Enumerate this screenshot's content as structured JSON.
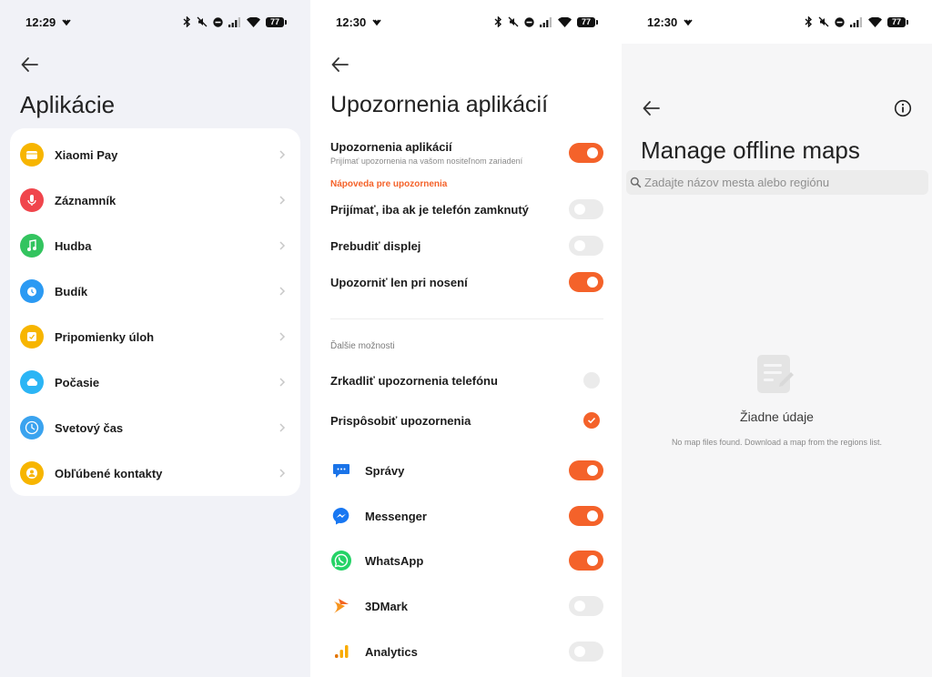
{
  "screen1": {
    "status": {
      "time": "12:29",
      "battery": "77"
    },
    "title": "Aplikácie",
    "apps": [
      {
        "label": "Xiaomi Pay",
        "icon": "wallet-icon",
        "color": "#f7b500"
      },
      {
        "label": "Záznamník",
        "icon": "microphone-icon",
        "color": "#f0454c"
      },
      {
        "label": "Hudba",
        "icon": "music-icon",
        "color": "#33c45f"
      },
      {
        "label": "Budík",
        "icon": "alarm-clock-icon",
        "color": "#2b9af3"
      },
      {
        "label": "Pripomienky úloh",
        "icon": "checklist-icon",
        "color": "#f7b500"
      },
      {
        "label": "Počasie",
        "icon": "cloud-icon",
        "color": "#2bb5f5"
      },
      {
        "label": "Svetový čas",
        "icon": "world-clock-icon",
        "color": "#3aa3ef"
      },
      {
        "label": "Obľúbené kontakty",
        "icon": "contact-icon",
        "color": "#f7b500"
      }
    ]
  },
  "screen2": {
    "status": {
      "time": "12:30",
      "battery": "77"
    },
    "title": "Upozornenia aplikácií",
    "main_toggle": {
      "label": "Upozornenia aplikácií",
      "sub": "Prijímať upozornenia na vašom nositeľnom zariadení",
      "on": true
    },
    "help_link": "Nápoveda pre upozornenia",
    "toggles": [
      {
        "label": "Prijímať, iba ak je telefón zamknutý",
        "on": false
      },
      {
        "label": "Prebudiť displej",
        "on": false
      },
      {
        "label": "Upozorniť len pri nosení",
        "on": true
      }
    ],
    "section_label": "Ďalšie možnosti",
    "options": [
      {
        "label": "Zrkadliť upozornenia telefónu",
        "selected": false
      },
      {
        "label": "Prispôsobiť upozornenia",
        "selected": true
      }
    ],
    "apps": [
      {
        "label": "Správy",
        "icon": "messages-icon",
        "on": true
      },
      {
        "label": "Messenger",
        "icon": "messenger-icon",
        "on": true
      },
      {
        "label": "WhatsApp",
        "icon": "whatsapp-icon",
        "on": true
      },
      {
        "label": "3DMark",
        "icon": "3dmark-icon",
        "on": false
      },
      {
        "label": "Analytics",
        "icon": "analytics-icon",
        "on": false
      }
    ],
    "accent": "#f4622a"
  },
  "screen3": {
    "status": {
      "time": "12:30",
      "battery": "77"
    },
    "title": "Manage offline maps",
    "search_placeholder": "Zadajte názov mesta alebo regiónu",
    "empty_title": "Žiadne údaje",
    "empty_sub": "No map files found. Download a map from the regions list."
  }
}
